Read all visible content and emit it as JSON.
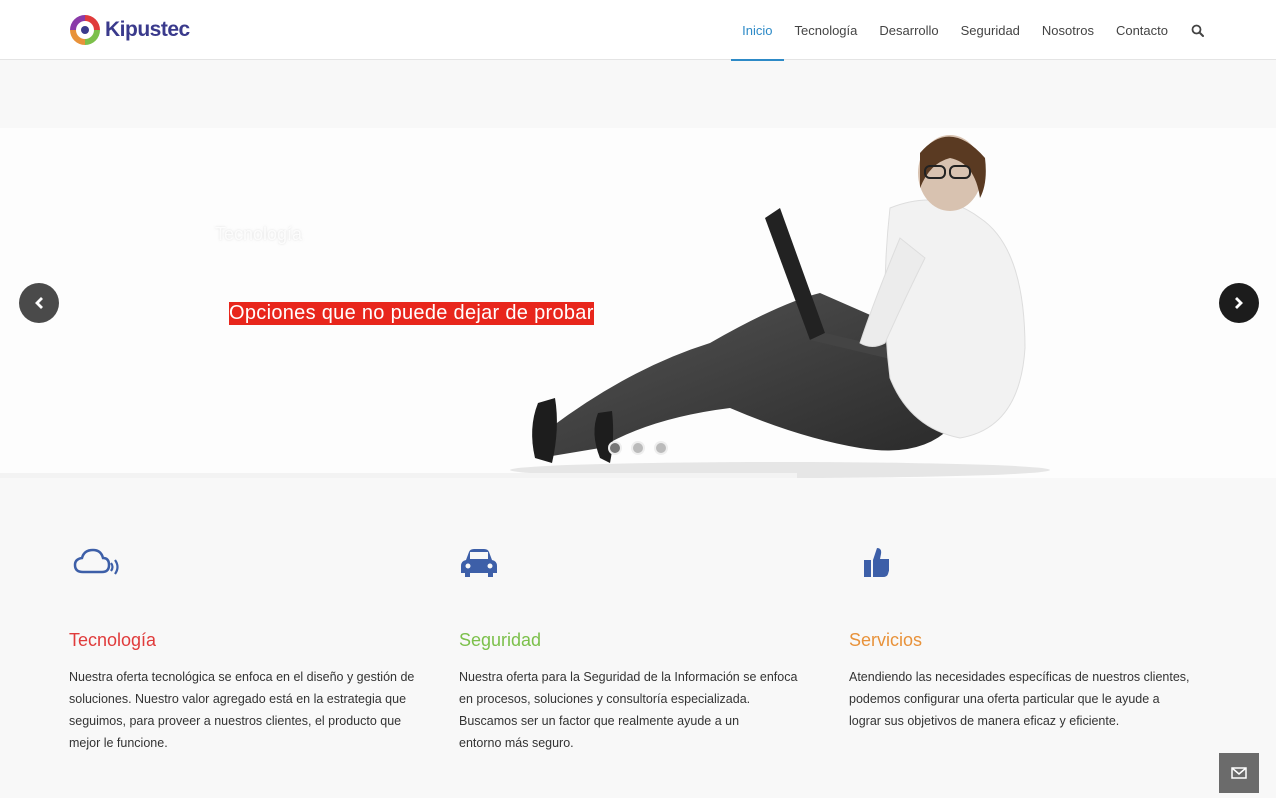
{
  "brand": {
    "name": "Kipustec"
  },
  "nav": {
    "items": [
      "Inicio",
      "Tecnología",
      "Desarrollo",
      "Seguridad",
      "Nosotros",
      "Contacto"
    ],
    "active": "Inicio"
  },
  "slider": {
    "title": "Tecnología",
    "caption": "Opciones que no puede dejar de probar",
    "slide_count": 3,
    "active_slide": 1
  },
  "features": [
    {
      "icon": "cloud-signal-icon",
      "title": "Tecnología",
      "color": "#e03b3b",
      "lines": [
        "Nuestra oferta tecnológica se enfoca en el diseño y gestión de",
        "soluciones. Nuestro valor agregado está en la estrategia que",
        "seguimos, para proveer a nuestros clientes, el producto que",
        "mejor le funcione."
      ]
    },
    {
      "icon": "car-icon",
      "title": "Seguridad",
      "color": "#7cc04b",
      "lines": [
        "Nuestra oferta para la Seguridad de la Información se  enfoca",
        "en procesos,  soluciones y consultoría especializada.",
        "Buscamos ser un factor que realmente ayude a un",
        "entorno más seguro."
      ]
    },
    {
      "icon": "thumbs-up-icon",
      "title": "Servicios",
      "color": "#e8923a",
      "lines": [
        "Atendiendo las necesidades específicas de nuestros clientes,",
        "podemos configurar una oferta particular que le ayude a",
        "lograr sus objetivos de manera eficaz y eficiente."
      ]
    }
  ],
  "colors": {
    "accent": "#2d8ac7",
    "icon": "#3d5fa8",
    "caption_bg": "#e8261c"
  }
}
